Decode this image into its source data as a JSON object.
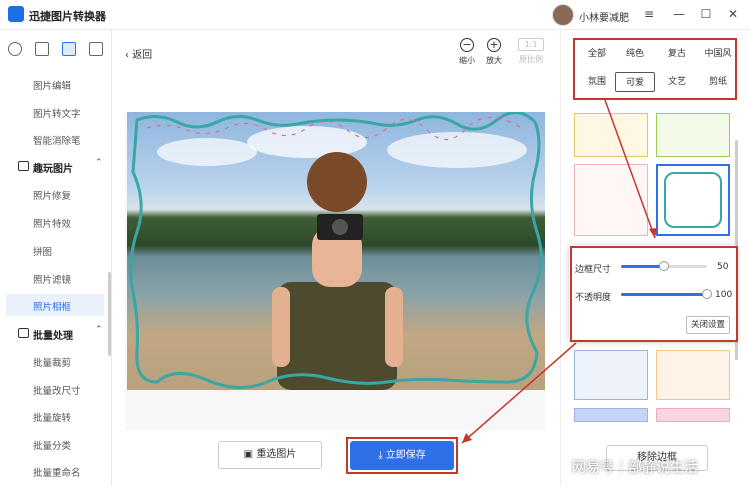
{
  "window": {
    "title": "迅捷图片转换器",
    "username": "小林要减肥",
    "menu_icon": "≡",
    "min_icon": "—",
    "max_icon": "☐",
    "close_icon": "✕"
  },
  "sidebar": {
    "items": [
      {
        "label": "图片编辑",
        "type": "sub"
      },
      {
        "label": "图片转文字",
        "type": "sub"
      },
      {
        "label": "智能消除笔",
        "type": "sub"
      },
      {
        "label": "趣玩图片",
        "type": "group"
      },
      {
        "label": "照片修复",
        "type": "sub"
      },
      {
        "label": "照片特效",
        "type": "sub"
      },
      {
        "label": "拼图",
        "type": "sub"
      },
      {
        "label": "照片滤镜",
        "type": "sub"
      },
      {
        "label": "照片相框",
        "type": "sub",
        "active": true
      },
      {
        "label": "批量处理",
        "type": "group"
      },
      {
        "label": "批量裁剪",
        "type": "sub"
      },
      {
        "label": "批量改尺寸",
        "type": "sub"
      },
      {
        "label": "批量旋转",
        "type": "sub"
      },
      {
        "label": "批量分类",
        "type": "sub"
      },
      {
        "label": "批量重命名",
        "type": "sub"
      }
    ]
  },
  "main": {
    "back_label": "返回",
    "tools": {
      "zoom_out": "缩小",
      "zoom_in": "放大",
      "original": "原比例",
      "original_box": "1:1"
    },
    "reselect_label": "重选图片",
    "save_label": "立即保存"
  },
  "right": {
    "tags": [
      "全部",
      "纯色",
      "复古",
      "中国风",
      "氛围",
      "可爱",
      "文艺",
      "复古"
    ],
    "tags_row2_last": "剪纸",
    "active_tag": "可爱",
    "settings": {
      "size_label": "边框尺寸",
      "size_value": "50",
      "opacity_label": "不透明度",
      "opacity_value": "100",
      "close_label": "关闭设置",
      "size_pct": 50,
      "opacity_pct": 100
    },
    "bottom_label": "移除边框"
  },
  "watermark": "网易号｜部静说生活",
  "colors": {
    "accent": "#2f6fe8",
    "highlight": "#c0392b",
    "frame": "#3aa6a6"
  }
}
